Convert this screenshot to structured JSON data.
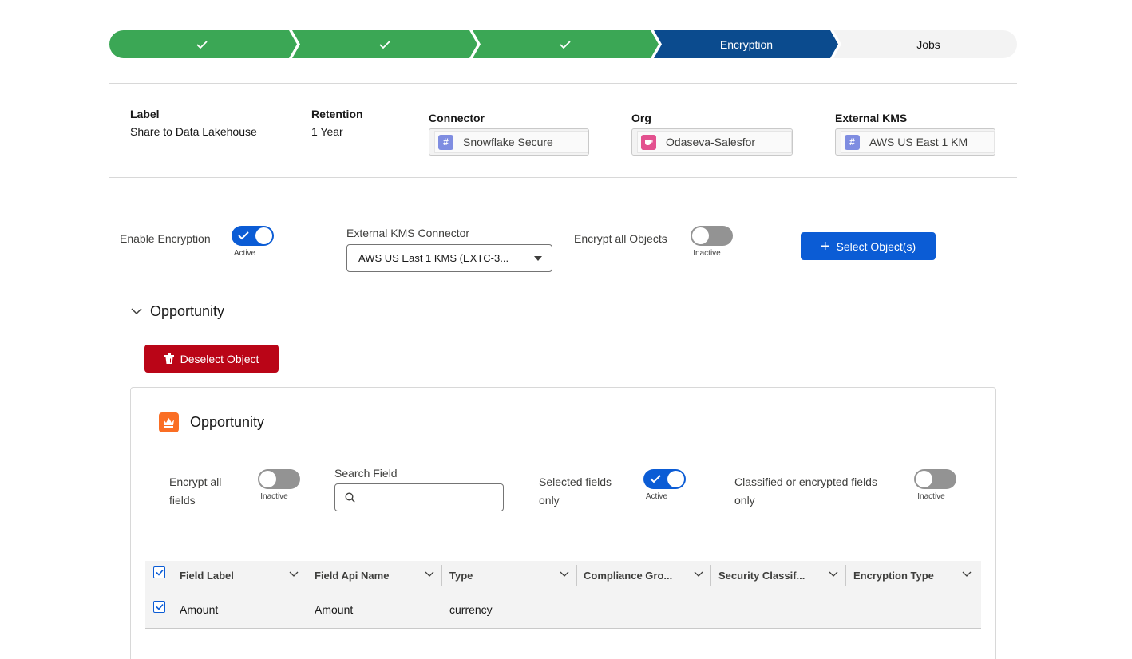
{
  "path": {
    "steps": [
      {
        "label": "",
        "state": "complete"
      },
      {
        "label": "",
        "state": "complete"
      },
      {
        "label": "",
        "state": "complete"
      },
      {
        "label": "Encryption",
        "state": "current"
      },
      {
        "label": "Jobs",
        "state": "incomplete"
      }
    ]
  },
  "header": {
    "label": {
      "title": "Label",
      "value": "Share to Data Lakehouse"
    },
    "retention": {
      "title": "Retention",
      "value": "1 Year"
    },
    "connector": {
      "title": "Connector",
      "value": "Snowflake Secure",
      "icon": "hash-icon"
    },
    "org": {
      "title": "Org",
      "value": "Odaseva-Salesfor",
      "icon": "cup-icon"
    },
    "external_kms": {
      "title": "External KMS",
      "value": "AWS US East 1 KM",
      "icon": "hash-icon"
    }
  },
  "settings": {
    "enable_encryption": {
      "label": "Enable Encryption",
      "state": "Active",
      "on": true
    },
    "kms_connector": {
      "label": "External KMS Connector",
      "value": "AWS US East 1 KMS (EXTC-3..."
    },
    "encrypt_all_objects": {
      "label": "Encrypt all Objects",
      "state": "Inactive",
      "on": false
    },
    "select_objects_button": "Select Object(s)"
  },
  "section": {
    "title": "Opportunity",
    "deselect_button": "Deselect Object"
  },
  "card": {
    "title": "Opportunity",
    "encrypt_all_fields": {
      "line1": "Encrypt all",
      "line2": "fields",
      "state": "Inactive",
      "on": false
    },
    "search": {
      "label": "Search Field",
      "value": "",
      "placeholder": ""
    },
    "selected_fields_only": {
      "line1": "Selected fields",
      "line2": "only",
      "state": "Active",
      "on": true
    },
    "classified_only": {
      "line1": "Classified or encrypted fields",
      "line2": "only",
      "state": "Inactive",
      "on": false
    }
  },
  "table": {
    "columns": [
      "Field Label",
      "Field Api Name",
      "Type",
      "Compliance Gro...",
      "Security Classif...",
      "Encryption Type"
    ],
    "rows": [
      {
        "selected": true,
        "cells": [
          "Amount",
          "Amount",
          "currency",
          "",
          "",
          ""
        ]
      }
    ]
  },
  "colors": {
    "complete": "#3ba755",
    "current": "#0b4b8e",
    "brand": "#0b5cd5",
    "destructive": "#ba0517",
    "object_icon": "#fa6e24"
  }
}
